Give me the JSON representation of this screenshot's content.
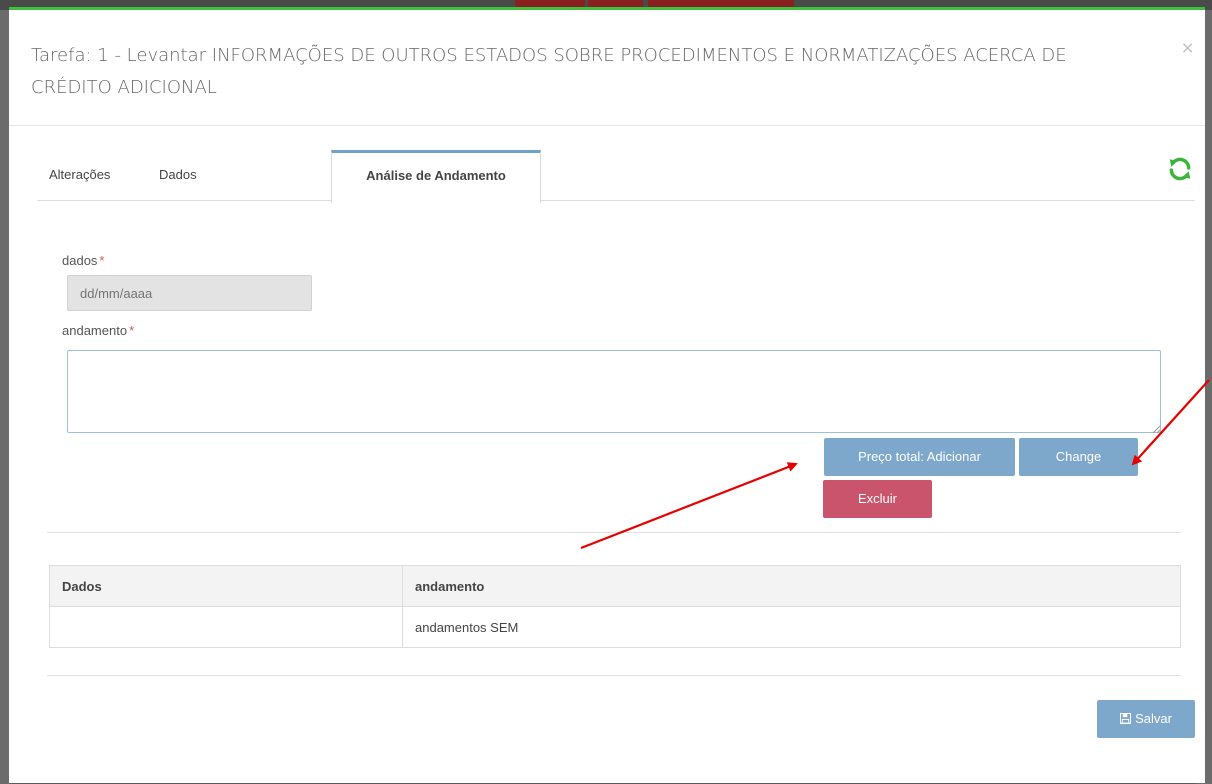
{
  "modal": {
    "title": "Tarefa: 1 - Levantar INFORMAÇÕES DE OUTROS ESTADOS SOBRE PROCEDIMENTOS E NORMATIZAÇÕES ACERCA DE CRÉDITO ADICIONAL",
    "close_label": "×"
  },
  "tabs": [
    {
      "label": "Alterações"
    },
    {
      "label": "Dados"
    },
    {
      "label": "Análise de Andamento",
      "active": true
    }
  ],
  "icons": {
    "refresh": "refresh-icon",
    "save": "floppy-disk-icon",
    "close": "close-icon"
  },
  "form": {
    "date_label": "dados",
    "date_placeholder": "dd/mm/aaaa",
    "progress_label": "andamento",
    "required_mark": "*"
  },
  "buttons": {
    "add": "Preço total: Adicionar",
    "change": "Change",
    "delete": "Excluir",
    "save": "Salvar"
  },
  "table": {
    "headers": [
      "Dados",
      "andamento"
    ],
    "rows": [
      [
        "",
        "andamentos SEM"
      ]
    ]
  },
  "colors": {
    "accent_green": "#3fbf3f",
    "button_blue": "#7ea7cc",
    "button_red": "#c9546c",
    "annotation_arrow": "#e60000"
  }
}
